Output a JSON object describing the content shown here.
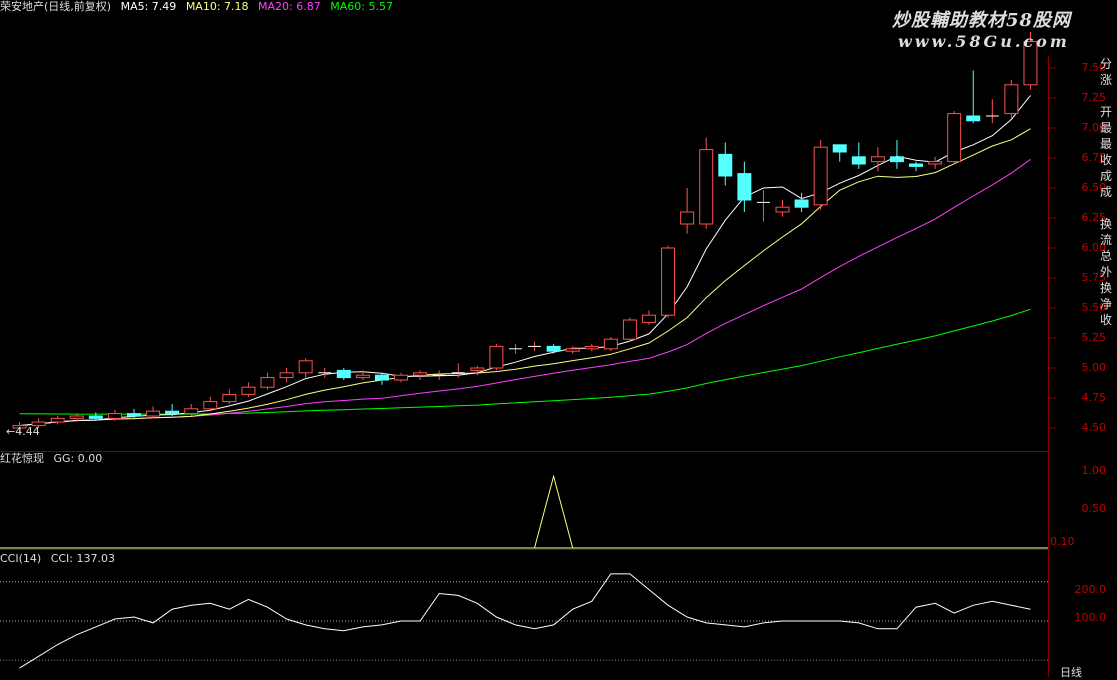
{
  "header": {
    "main_title": "荣安地产(日线,前复权)",
    "ma5": "MA5: 7.49",
    "ma10": "MA10: 7.18",
    "ma20": "MA20: 6.87",
    "ma60": "MA60: 5.57"
  },
  "watermark": {
    "line1": "炒股輔助教材58股网",
    "line2": "www.58Gu.com"
  },
  "price_low_label": "←4.44",
  "price_axis": [
    "7.50",
    "7.25",
    "7.00",
    "6.75",
    "6.50",
    "6.25",
    "6.00",
    "5.75",
    "5.50",
    "5.25",
    "5.00",
    "4.75",
    "4.50"
  ],
  "indicator1": {
    "title": "红花惊现",
    "value": "GG: 0.00",
    "axis": [
      "1.00",
      "0.50"
    ],
    "unit": "0.10"
  },
  "indicator2": {
    "title": "CCI(14)",
    "value": "CCI: 137.03",
    "axis": [
      "200.0",
      "100.0"
    ]
  },
  "bottom_right_label": "日线",
  "side_panel": [
    "分",
    "涨",
    "",
    "开",
    "最",
    "最",
    "收",
    "成",
    "成",
    "",
    "换",
    "流",
    "总",
    "外",
    "换",
    "净",
    "收"
  ],
  "colors": {
    "up": "#ff5050",
    "down": "#54ffff",
    "ma5": "#ffffff",
    "ma10": "#ffff80",
    "ma20": "#ff40ff",
    "ma60": "#00ff00",
    "grid": "#8a0000"
  },
  "chart_data": {
    "type": "candlestick",
    "price_ylim": [
      4.4,
      7.6
    ],
    "candles": [
      [
        4.5,
        4.52,
        4.55,
        4.46
      ],
      [
        4.52,
        4.55,
        4.58,
        4.5
      ],
      [
        4.55,
        4.58,
        4.6,
        4.53
      ],
      [
        4.58,
        4.6,
        4.62,
        4.55
      ],
      [
        4.6,
        4.58,
        4.63,
        4.56
      ],
      [
        4.58,
        4.62,
        4.65,
        4.56
      ],
      [
        4.62,
        4.6,
        4.66,
        4.58
      ],
      [
        4.6,
        4.64,
        4.68,
        4.58
      ],
      [
        4.64,
        4.62,
        4.7,
        4.6
      ],
      [
        4.62,
        4.66,
        4.7,
        4.6
      ],
      [
        4.66,
        4.72,
        4.76,
        4.64
      ],
      [
        4.72,
        4.78,
        4.82,
        4.7
      ],
      [
        4.78,
        4.84,
        4.88,
        4.76
      ],
      [
        4.84,
        4.92,
        4.96,
        4.82
      ],
      [
        4.92,
        4.96,
        5.0,
        4.88
      ],
      [
        4.96,
        5.06,
        5.08,
        4.92
      ],
      [
        4.96,
        4.96,
        5.0,
        4.92
      ],
      [
        4.98,
        4.92,
        5.0,
        4.9
      ],
      [
        4.92,
        4.94,
        4.98,
        4.9
      ],
      [
        4.94,
        4.9,
        4.96,
        4.86
      ],
      [
        4.9,
        4.94,
        4.96,
        4.88
      ],
      [
        4.94,
        4.96,
        4.98,
        4.9
      ],
      [
        4.94,
        4.94,
        4.98,
        4.9
      ],
      [
        4.96,
        4.96,
        5.04,
        4.92
      ],
      [
        4.98,
        5.0,
        5.02,
        4.94
      ],
      [
        5.0,
        5.18,
        5.2,
        4.98
      ],
      [
        5.16,
        5.16,
        5.2,
        5.12
      ],
      [
        5.18,
        5.18,
        5.22,
        5.14
      ],
      [
        5.18,
        5.14,
        5.2,
        5.12
      ],
      [
        5.14,
        5.16,
        5.18,
        5.12
      ],
      [
        5.16,
        5.18,
        5.2,
        5.14
      ],
      [
        5.16,
        5.24,
        5.26,
        5.14
      ],
      [
        5.24,
        5.4,
        5.42,
        5.22
      ],
      [
        5.38,
        5.44,
        5.48,
        5.36
      ],
      [
        5.44,
        6.0,
        6.02,
        5.42
      ],
      [
        6.2,
        6.3,
        6.5,
        6.12
      ],
      [
        6.2,
        6.82,
        6.92,
        6.16
      ],
      [
        6.78,
        6.6,
        6.88,
        6.52
      ],
      [
        6.62,
        6.4,
        6.72,
        6.3
      ],
      [
        6.38,
        6.38,
        6.48,
        6.22
      ],
      [
        6.3,
        6.34,
        6.4,
        6.26
      ],
      [
        6.4,
        6.34,
        6.46,
        6.3
      ],
      [
        6.36,
        6.84,
        6.9,
        6.32
      ],
      [
        6.86,
        6.8,
        6.86,
        6.72
      ],
      [
        6.76,
        6.7,
        6.88,
        6.66
      ],
      [
        6.72,
        6.76,
        6.84,
        6.64
      ],
      [
        6.76,
        6.72,
        6.9,
        6.66
      ],
      [
        6.7,
        6.68,
        6.72,
        6.64
      ],
      [
        6.7,
        6.72,
        6.76,
        6.66
      ],
      [
        6.72,
        7.12,
        7.14,
        6.7
      ],
      [
        7.1,
        7.06,
        7.48,
        7.04
      ],
      [
        7.1,
        7.1,
        7.24,
        7.04
      ],
      [
        7.12,
        7.36,
        7.4,
        7.08
      ],
      [
        7.36,
        7.72,
        7.8,
        7.32
      ]
    ],
    "gg_values": [
      0,
      0,
      0,
      0,
      0,
      0,
      0,
      0,
      0,
      0,
      0,
      0,
      0,
      0,
      0,
      0,
      0,
      0,
      0,
      0,
      0,
      0,
      0,
      0,
      0,
      0,
      0,
      0,
      1,
      0,
      0,
      0,
      0,
      0,
      0,
      0,
      0,
      0,
      0,
      0,
      0,
      0,
      0,
      0,
      0,
      0,
      0,
      0,
      0,
      0,
      0,
      0,
      0,
      0
    ],
    "gg_ylim": [
      0,
      1.2
    ],
    "cci_values": [
      -20,
      10,
      40,
      65,
      85,
      105,
      110,
      95,
      130,
      140,
      145,
      130,
      155,
      135,
      105,
      90,
      80,
      75,
      85,
      90,
      100,
      100,
      170,
      165,
      145,
      110,
      90,
      80,
      90,
      130,
      150,
      220,
      220,
      180,
      140,
      110,
      95,
      90,
      85,
      95,
      100,
      100,
      100,
      100,
      95,
      80,
      80,
      135,
      145,
      120,
      140,
      150,
      140,
      130
    ],
    "cci_ylim": [
      -30,
      240
    ],
    "cci_levels": [
      100,
      200
    ]
  }
}
